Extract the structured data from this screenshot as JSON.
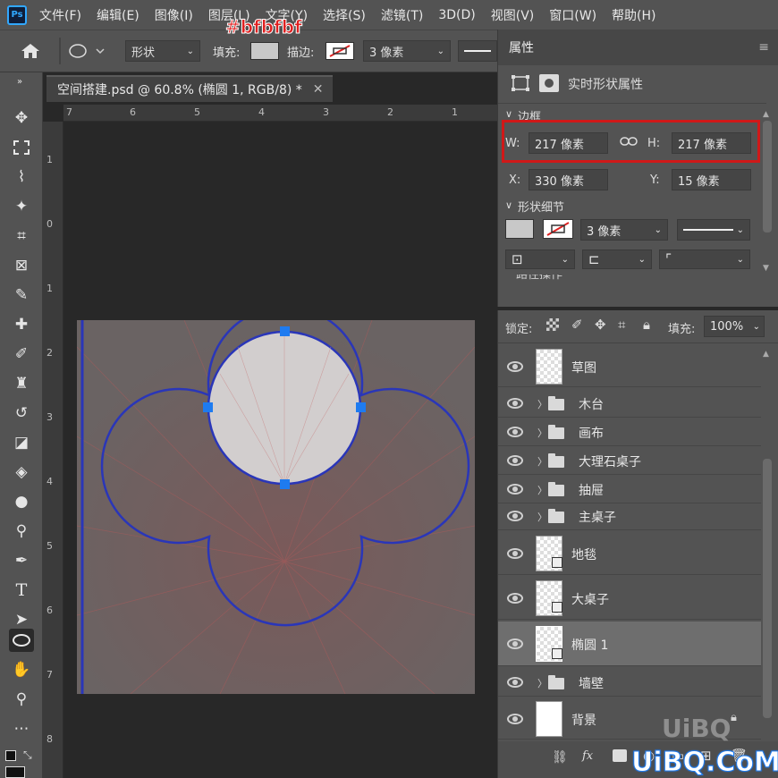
{
  "menu": {
    "logo": "Ps",
    "items": [
      "文件(F)",
      "编辑(E)",
      "图像(I)",
      "图层(L)",
      "文字(Y)",
      "选择(S)",
      "滤镜(T)",
      "3D(D)",
      "视图(V)",
      "窗口(W)",
      "帮助(H)"
    ]
  },
  "annotation": "#bfbfbf",
  "options": {
    "mode": "形状",
    "fill_label": "填充:",
    "stroke_label": "描边:",
    "stroke_width": "3 像素"
  },
  "document": {
    "tab_title": "空间搭建.psd @ 60.8% (椭圆 1, RGB/8) *",
    "close": "✕"
  },
  "rulers": {
    "top": [
      "7",
      "6",
      "5",
      "4",
      "3",
      "2",
      "1"
    ],
    "left": [
      "1",
      "0",
      "1",
      "2",
      "3",
      "4",
      "5",
      "6",
      "7",
      "8"
    ]
  },
  "properties": {
    "title": "属性",
    "subtitle": "实时形状属性",
    "section_bbox": "边框",
    "w_label": "W:",
    "w_value": "217 像素",
    "h_label": "H:",
    "h_value": "217 像素",
    "x_label": "X:",
    "x_value": "330 像素",
    "y_label": "Y:",
    "y_value": "15 像素",
    "section_shape": "形状细节",
    "stroke_width": "3 像素",
    "cut_text": "路径操作"
  },
  "layers_panel": {
    "lock_label": "锁定:",
    "fill_label": "填充:",
    "fill_value": "100%",
    "layers": [
      {
        "name": "草图",
        "type": "layer"
      },
      {
        "name": "木台",
        "type": "group"
      },
      {
        "name": "画布",
        "type": "group"
      },
      {
        "name": "大理石桌子",
        "type": "group"
      },
      {
        "name": "抽屉",
        "type": "group"
      },
      {
        "name": "主桌子",
        "type": "group"
      },
      {
        "name": "地毯",
        "type": "shape"
      },
      {
        "name": "大桌子",
        "type": "shape"
      },
      {
        "name": "椭圆 1",
        "type": "shape",
        "selected": true
      },
      {
        "name": "墙壁",
        "type": "group"
      },
      {
        "name": "背景",
        "type": "background"
      }
    ],
    "footer_fx": "fx"
  },
  "watermark": {
    "top": "UiBQ",
    "bottom": "UiBQ.CoM"
  },
  "colors": {
    "accent_handle": "#1e7bf0",
    "shape_stroke": "#2a36b8",
    "highlight_box": "#d01818"
  }
}
